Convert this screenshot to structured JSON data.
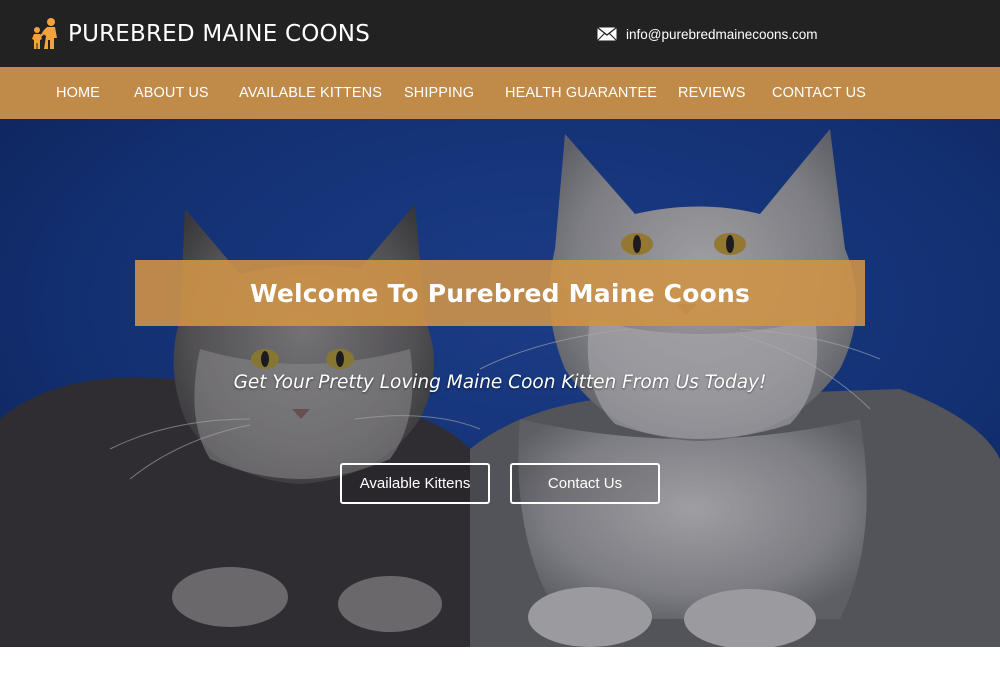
{
  "header": {
    "logo_text": "PUREBRED MAINE COONS",
    "logo_icon": "woman-with-child-icon",
    "email_icon": "envelope-icon",
    "email": "info@purebredmainecoons.com"
  },
  "nav": {
    "items": [
      {
        "label": "HOME"
      },
      {
        "label": "ABOUT US"
      },
      {
        "label": "AVAILABLE KITTENS"
      },
      {
        "label": "SHIPPING"
      },
      {
        "label": "HEALTH GUARANTEE"
      },
      {
        "label": "REVIEWS"
      },
      {
        "label": "CONTACT US"
      }
    ]
  },
  "hero": {
    "title": "Welcome To Purebred Maine Coons",
    "tagline": "Get Your Pretty Loving Maine Coon Kitten From Us Today!",
    "primary_button": "Available Kittens",
    "secondary_button": "Contact Us"
  },
  "colors": {
    "topbar": "#222222",
    "nav": "#c08a48",
    "accent": "#f4a33c",
    "banner": "#ce9248",
    "hero_bg": "#1a3a86"
  }
}
